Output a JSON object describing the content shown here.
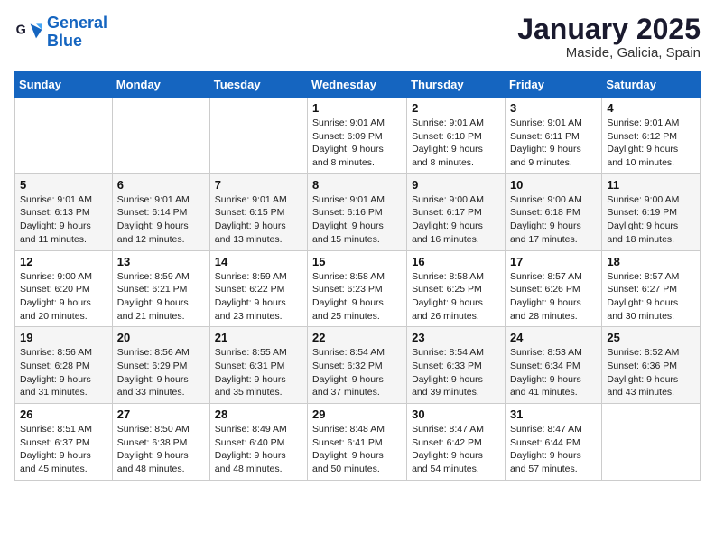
{
  "header": {
    "logo_line1": "General",
    "logo_line2": "Blue",
    "month": "January 2025",
    "location": "Maside, Galicia, Spain"
  },
  "days_of_week": [
    "Sunday",
    "Monday",
    "Tuesday",
    "Wednesday",
    "Thursday",
    "Friday",
    "Saturday"
  ],
  "weeks": [
    [
      {
        "day": "",
        "info": ""
      },
      {
        "day": "",
        "info": ""
      },
      {
        "day": "",
        "info": ""
      },
      {
        "day": "1",
        "info": "Sunrise: 9:01 AM\nSunset: 6:09 PM\nDaylight: 9 hours and 8 minutes."
      },
      {
        "day": "2",
        "info": "Sunrise: 9:01 AM\nSunset: 6:10 PM\nDaylight: 9 hours and 8 minutes."
      },
      {
        "day": "3",
        "info": "Sunrise: 9:01 AM\nSunset: 6:11 PM\nDaylight: 9 hours and 9 minutes."
      },
      {
        "day": "4",
        "info": "Sunrise: 9:01 AM\nSunset: 6:12 PM\nDaylight: 9 hours and 10 minutes."
      }
    ],
    [
      {
        "day": "5",
        "info": "Sunrise: 9:01 AM\nSunset: 6:13 PM\nDaylight: 9 hours and 11 minutes."
      },
      {
        "day": "6",
        "info": "Sunrise: 9:01 AM\nSunset: 6:14 PM\nDaylight: 9 hours and 12 minutes."
      },
      {
        "day": "7",
        "info": "Sunrise: 9:01 AM\nSunset: 6:15 PM\nDaylight: 9 hours and 13 minutes."
      },
      {
        "day": "8",
        "info": "Sunrise: 9:01 AM\nSunset: 6:16 PM\nDaylight: 9 hours and 15 minutes."
      },
      {
        "day": "9",
        "info": "Sunrise: 9:00 AM\nSunset: 6:17 PM\nDaylight: 9 hours and 16 minutes."
      },
      {
        "day": "10",
        "info": "Sunrise: 9:00 AM\nSunset: 6:18 PM\nDaylight: 9 hours and 17 minutes."
      },
      {
        "day": "11",
        "info": "Sunrise: 9:00 AM\nSunset: 6:19 PM\nDaylight: 9 hours and 18 minutes."
      }
    ],
    [
      {
        "day": "12",
        "info": "Sunrise: 9:00 AM\nSunset: 6:20 PM\nDaylight: 9 hours and 20 minutes."
      },
      {
        "day": "13",
        "info": "Sunrise: 8:59 AM\nSunset: 6:21 PM\nDaylight: 9 hours and 21 minutes."
      },
      {
        "day": "14",
        "info": "Sunrise: 8:59 AM\nSunset: 6:22 PM\nDaylight: 9 hours and 23 minutes."
      },
      {
        "day": "15",
        "info": "Sunrise: 8:58 AM\nSunset: 6:23 PM\nDaylight: 9 hours and 25 minutes."
      },
      {
        "day": "16",
        "info": "Sunrise: 8:58 AM\nSunset: 6:25 PM\nDaylight: 9 hours and 26 minutes."
      },
      {
        "day": "17",
        "info": "Sunrise: 8:57 AM\nSunset: 6:26 PM\nDaylight: 9 hours and 28 minutes."
      },
      {
        "day": "18",
        "info": "Sunrise: 8:57 AM\nSunset: 6:27 PM\nDaylight: 9 hours and 30 minutes."
      }
    ],
    [
      {
        "day": "19",
        "info": "Sunrise: 8:56 AM\nSunset: 6:28 PM\nDaylight: 9 hours and 31 minutes."
      },
      {
        "day": "20",
        "info": "Sunrise: 8:56 AM\nSunset: 6:29 PM\nDaylight: 9 hours and 33 minutes."
      },
      {
        "day": "21",
        "info": "Sunrise: 8:55 AM\nSunset: 6:31 PM\nDaylight: 9 hours and 35 minutes."
      },
      {
        "day": "22",
        "info": "Sunrise: 8:54 AM\nSunset: 6:32 PM\nDaylight: 9 hours and 37 minutes."
      },
      {
        "day": "23",
        "info": "Sunrise: 8:54 AM\nSunset: 6:33 PM\nDaylight: 9 hours and 39 minutes."
      },
      {
        "day": "24",
        "info": "Sunrise: 8:53 AM\nSunset: 6:34 PM\nDaylight: 9 hours and 41 minutes."
      },
      {
        "day": "25",
        "info": "Sunrise: 8:52 AM\nSunset: 6:36 PM\nDaylight: 9 hours and 43 minutes."
      }
    ],
    [
      {
        "day": "26",
        "info": "Sunrise: 8:51 AM\nSunset: 6:37 PM\nDaylight: 9 hours and 45 minutes."
      },
      {
        "day": "27",
        "info": "Sunrise: 8:50 AM\nSunset: 6:38 PM\nDaylight: 9 hours and 48 minutes."
      },
      {
        "day": "28",
        "info": "Sunrise: 8:49 AM\nSunset: 6:40 PM\nDaylight: 9 hours and 48 minutes."
      },
      {
        "day": "29",
        "info": "Sunrise: 8:48 AM\nSunset: 6:41 PM\nDaylight: 9 hours and 50 minutes."
      },
      {
        "day": "30",
        "info": "Sunrise: 8:47 AM\nSunset: 6:42 PM\nDaylight: 9 hours and 54 minutes."
      },
      {
        "day": "31",
        "info": "Sunrise: 8:47 AM\nSunset: 6:44 PM\nDaylight: 9 hours and 57 minutes."
      },
      {
        "day": "",
        "info": ""
      }
    ]
  ]
}
